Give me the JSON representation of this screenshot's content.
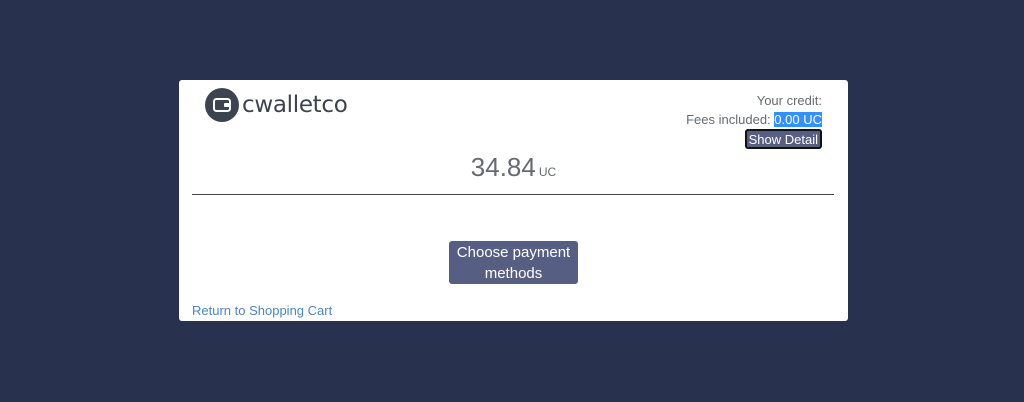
{
  "brand": {
    "name": "cwalletco",
    "logo_icon": "wallet-icon"
  },
  "credit": {
    "label": "Your credit:",
    "fees_label": "Fees included:",
    "fees_value": "0.00 UC",
    "detail_button_label": "Show Detail"
  },
  "amount": {
    "value": "34.84",
    "unit": "UC"
  },
  "actions": {
    "choose_payment_label": "Choose payment methods",
    "return_link_label": "Return to Shopping Cart"
  },
  "colors": {
    "background": "#28324e",
    "button": "#565f83",
    "link": "#4a86c5",
    "selection": "#3390ff"
  }
}
